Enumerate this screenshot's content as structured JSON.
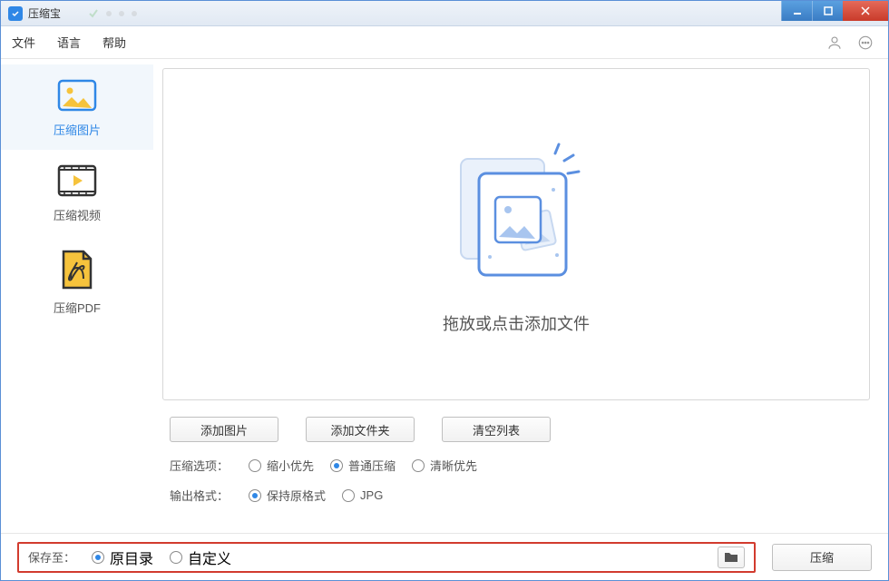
{
  "title": "压缩宝",
  "menu": {
    "file": "文件",
    "language": "语言",
    "help": "帮助"
  },
  "sidebar": {
    "items": [
      {
        "label": "压缩图片"
      },
      {
        "label": "压缩视频"
      },
      {
        "label": "压缩PDF"
      }
    ]
  },
  "drop": {
    "text": "拖放或点击添加文件"
  },
  "buttons": {
    "add_image": "添加图片",
    "add_folder": "添加文件夹",
    "clear_list": "清空列表"
  },
  "options": {
    "compress_label": "压缩选项：",
    "compress": {
      "size_priority": "缩小优先",
      "normal": "普通压缩",
      "clarity_priority": "清晰优先"
    },
    "format_label": "输出格式：",
    "format": {
      "keep": "保持原格式",
      "jpg": "JPG"
    }
  },
  "bottom": {
    "save_to": "保存至：",
    "original_dir": "原目录",
    "custom": "自定义",
    "compress": "压缩"
  }
}
